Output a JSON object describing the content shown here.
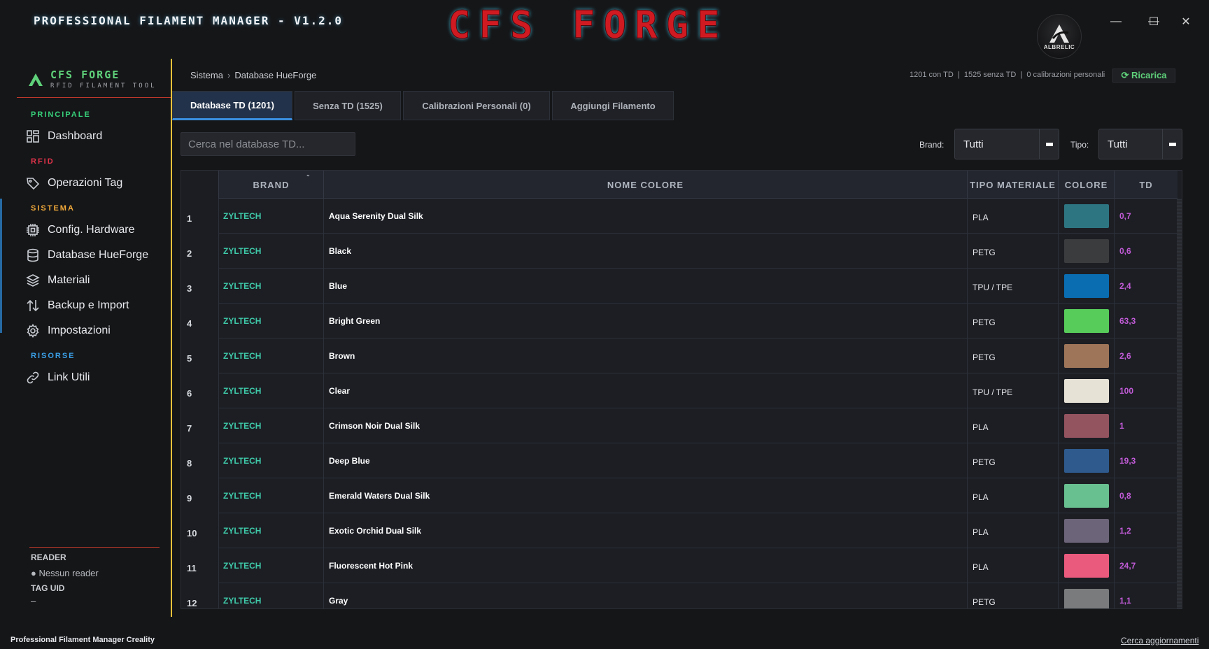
{
  "window": {
    "title": "PROFESSIONAL FILAMENT MANAGER - V1.2.0",
    "logo_text": "CFS FORGE",
    "avatar_text": "ALBRELIC",
    "controls": {
      "minimize": "—",
      "maximize": "☐",
      "close": "✕"
    }
  },
  "sidebar": {
    "brand_name": "CFS FORGE",
    "brand_sub": "RFID FILAMENT TOOL",
    "sections": [
      {
        "label": "PRINCIPALE",
        "color": "#37d07a",
        "items": [
          {
            "label": "Dashboard",
            "icon": "dashboard-icon"
          }
        ]
      },
      {
        "label": "RFID",
        "color": "#e0334a",
        "items": [
          {
            "label": "Operazioni Tag",
            "icon": "tag-icon"
          }
        ]
      },
      {
        "label": "SISTEMA",
        "color": "#f0a93a",
        "items": [
          {
            "label": "Config. Hardware",
            "icon": "chip-icon"
          },
          {
            "label": "Database HueForge",
            "icon": "database-icon"
          },
          {
            "label": "Materiali",
            "icon": "layers-icon"
          },
          {
            "label": "Backup e Import",
            "icon": "transfer-icon"
          },
          {
            "label": "Impostazioni",
            "icon": "gear-icon"
          }
        ]
      },
      {
        "label": "RISORSE",
        "color": "#3aa0e8",
        "items": [
          {
            "label": "Link Utili",
            "icon": "link-icon"
          }
        ]
      }
    ],
    "reader": {
      "label": "READER",
      "value": "● Nessun reader",
      "uid_label": "TAG UID",
      "uid_value": "–"
    }
  },
  "header": {
    "breadcrumb": [
      "Sistema",
      "Database HueForge"
    ],
    "breadcrumb_sep": "›",
    "stats": "1201 con TD  |  1525 senza TD  |  0 calibrazioni personali",
    "reload_label": "⟳ Ricarica"
  },
  "tabs": [
    {
      "label": "Database TD (1201)",
      "active": true
    },
    {
      "label": "Senza TD (1525)",
      "active": false
    },
    {
      "label": "Calibrazioni Personali (0)",
      "active": false
    },
    {
      "label": "Aggiungi Filamento",
      "active": false
    }
  ],
  "filters": {
    "search_placeholder": "Cerca nel database TD...",
    "brand_label": "Brand:",
    "brand_value": "Tutti",
    "type_label": "Tipo:",
    "type_value": "Tutti"
  },
  "table": {
    "columns": [
      "",
      "BRAND",
      "NOME COLORE",
      "TIPO MATERIALE",
      "COLORE",
      "TD"
    ],
    "rows": [
      {
        "idx": "1",
        "brand": "ZYLTECH",
        "name": "Aqua Serenity Dual Silk",
        "type": "PLA",
        "color": "#2e7582",
        "td": "0,7"
      },
      {
        "idx": "2",
        "brand": "ZYLTECH",
        "name": "Black",
        "type": "PETG",
        "color": "#3b3c3e",
        "td": "0,6"
      },
      {
        "idx": "3",
        "brand": "ZYLTECH",
        "name": "Blue",
        "type": "TPU / TPE",
        "color": "#0a6db2",
        "td": "2,4"
      },
      {
        "idx": "4",
        "brand": "ZYLTECH",
        "name": "Bright Green",
        "type": "PETG",
        "color": "#57cc5a",
        "td": "63,3"
      },
      {
        "idx": "5",
        "brand": "ZYLTECH",
        "name": "Brown",
        "type": "PETG",
        "color": "#9e7558",
        "td": "2,6"
      },
      {
        "idx": "6",
        "brand": "ZYLTECH",
        "name": "Clear",
        "type": "TPU / TPE",
        "color": "#e6e2d6",
        "td": "100"
      },
      {
        "idx": "7",
        "brand": "ZYLTECH",
        "name": "Crimson Noir Dual Silk",
        "type": "PLA",
        "color": "#93535f",
        "td": "1"
      },
      {
        "idx": "8",
        "brand": "ZYLTECH",
        "name": "Deep Blue",
        "type": "PETG",
        "color": "#2e5a8e",
        "td": "19,3"
      },
      {
        "idx": "9",
        "brand": "ZYLTECH",
        "name": "Emerald Waters Dual Silk",
        "type": "PLA",
        "color": "#68bf8f",
        "td": "0,8"
      },
      {
        "idx": "10",
        "brand": "ZYLTECH",
        "name": "Exotic Orchid Dual Silk",
        "type": "PLA",
        "color": "#6c6478",
        "td": "1,2"
      },
      {
        "idx": "11",
        "brand": "ZYLTECH",
        "name": "Fluorescent Hot Pink",
        "type": "PLA",
        "color": "#ea5a7c",
        "td": "24,7"
      },
      {
        "idx": "12",
        "brand": "ZYLTECH",
        "name": "Gray",
        "type": "PETG",
        "color": "#7a7b7c",
        "td": "1,1"
      }
    ]
  },
  "footer": {
    "left": "Professional Filament Manager Creality",
    "right": "Cerca aggiornamenti"
  }
}
